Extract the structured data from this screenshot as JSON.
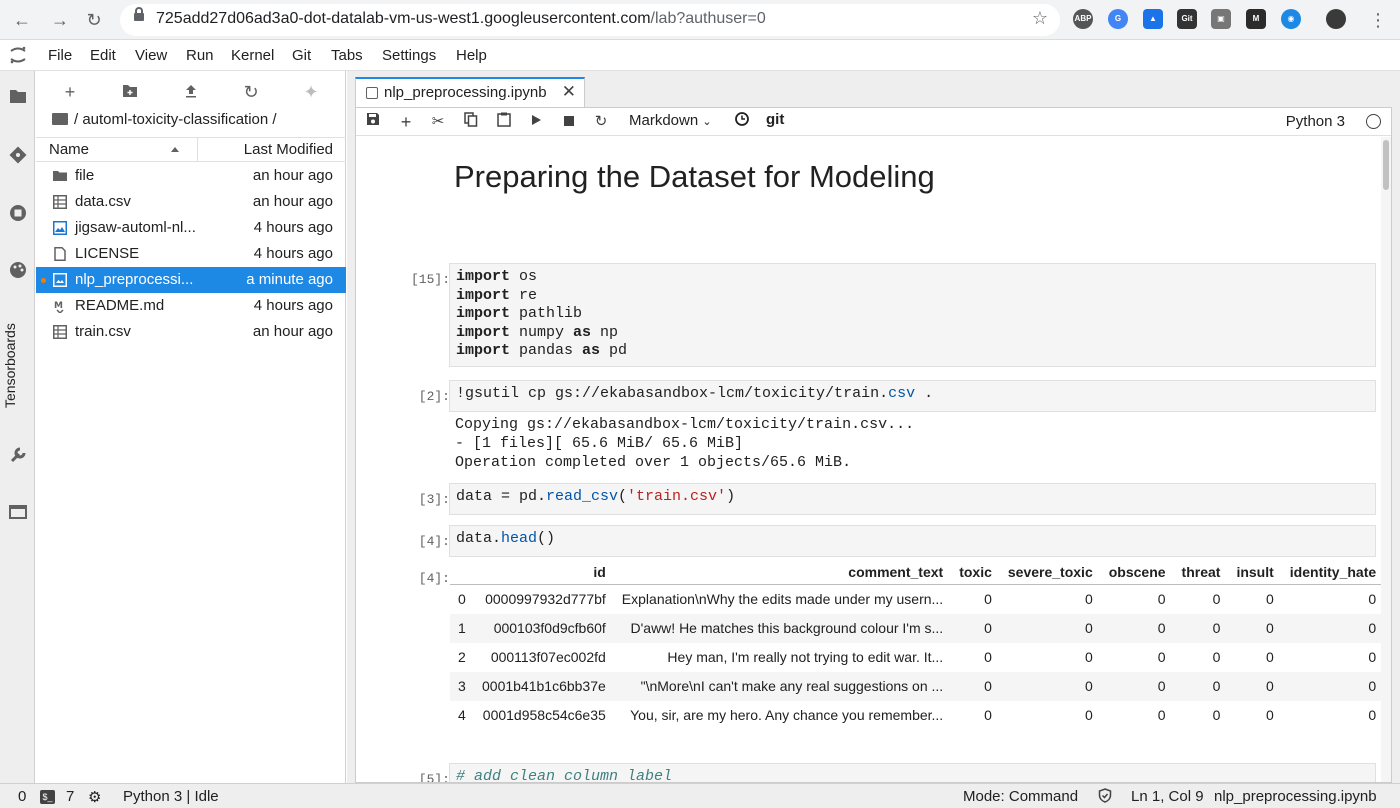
{
  "browser": {
    "url_host": "725add27d06ad3a0-dot-datalab-vm-us-west1.googleusercontent.com",
    "url_path": "/lab?authuser=0"
  },
  "menu": [
    "File",
    "Edit",
    "View",
    "Run",
    "Kernel",
    "Git",
    "Tabs",
    "Settings",
    "Help"
  ],
  "sidebar": {
    "tensorboards_label": "Tensorboards"
  },
  "filebrowser": {
    "breadcrumb": "/ automl-toxicity-classification /",
    "col_name": "Name",
    "col_modified": "Last Modified",
    "files": [
      {
        "name": "file",
        "modified": "an hour ago",
        "icon": "folder-icon"
      },
      {
        "name": "data.csv",
        "modified": "an hour ago",
        "icon": "spreadsheet-icon"
      },
      {
        "name": "jigsaw-automl-nl...",
        "modified": "4 hours ago",
        "icon": "image-icon"
      },
      {
        "name": "LICENSE",
        "modified": "4 hours ago",
        "icon": "file-icon"
      },
      {
        "name": "nlp_preprocessi...",
        "modified": "a minute ago",
        "icon": "notebook-icon",
        "selected": true
      },
      {
        "name": "README.md",
        "modified": "4 hours ago",
        "icon": "markdown-icon"
      },
      {
        "name": "train.csv",
        "modified": "an hour ago",
        "icon": "spreadsheet-icon"
      }
    ]
  },
  "tab": {
    "label": "nlp_preprocessing.ipynb"
  },
  "toolbar": {
    "cell_type": "Markdown",
    "git_label": "git",
    "kernel": "Python 3"
  },
  "notebook": {
    "title": "Preparing the Dataset for Modeling",
    "prompts": [
      "[15]:",
      "[2]:",
      "[3]:",
      "[4]:",
      "[4]:",
      "[5]:"
    ],
    "output_2": "Copying gs://ekabasandbox-lcm/toxicity/train.csv...\n- [1 files][ 65.6 MiB/ 65.6 MiB]\nOperation completed over 1 objects/65.6 MiB.",
    "dataframe": {
      "columns": [
        "",
        "id",
        "comment_text",
        "toxic",
        "severe_toxic",
        "obscene",
        "threat",
        "insult",
        "identity_hate"
      ],
      "rows": [
        [
          "0",
          "0000997932d777bf",
          "Explanation\\nWhy the edits made under my usern...",
          "0",
          "0",
          "0",
          "0",
          "0",
          "0"
        ],
        [
          "1",
          "000103f0d9cfb60f",
          "D'aww! He matches this background colour I'm s...",
          "0",
          "0",
          "0",
          "0",
          "0",
          "0"
        ],
        [
          "2",
          "000113f07ec002fd",
          "Hey man, I'm really not trying to edit war. It...",
          "0",
          "0",
          "0",
          "0",
          "0",
          "0"
        ],
        [
          "3",
          "0001b41b1c6bb37e",
          "\"\\nMore\\nI can't make any real suggestions on ...",
          "0",
          "0",
          "0",
          "0",
          "0",
          "0"
        ],
        [
          "4",
          "0001d958c54c6e35",
          "You, sir, are my hero. Any chance you remember...",
          "0",
          "0",
          "0",
          "0",
          "0",
          "0"
        ]
      ]
    }
  },
  "statusbar": {
    "count_a": "0",
    "count_b": "7",
    "kernel_status": "Python 3 | Idle",
    "mode": "Mode: Command",
    "cursor": "Ln 1, Col 9",
    "filename": "nlp_preprocessing.ipynb"
  }
}
